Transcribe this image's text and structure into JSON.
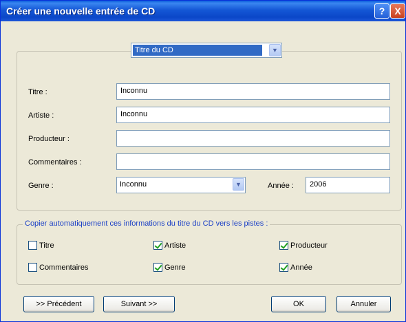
{
  "window": {
    "title": "Créer une nouvelle entrée de CD",
    "help_icon": "?",
    "close_icon": "X"
  },
  "field_selector": {
    "selected": "Titre du CD",
    "icon": "chevron-down-icon"
  },
  "fields": {
    "titre": {
      "label": "Titre :",
      "value": "Inconnu"
    },
    "artiste": {
      "label": "Artiste :",
      "value": "Inconnu"
    },
    "producteur": {
      "label": "Producteur :",
      "value": ""
    },
    "commentaires": {
      "label": "Commentaires :",
      "value": ""
    },
    "genre": {
      "label": "Genre :",
      "value": "Inconnu"
    },
    "annee": {
      "label": "Année :",
      "value": "2006"
    }
  },
  "copy_section": {
    "legend": "Copier automatiquement ces informations du titre du CD vers les pistes :",
    "options": [
      {
        "label": "Titre",
        "checked": false
      },
      {
        "label": "Artiste",
        "checked": true
      },
      {
        "label": "Producteur",
        "checked": true
      },
      {
        "label": "Commentaires",
        "checked": false
      },
      {
        "label": "Genre",
        "checked": true
      },
      {
        "label": "Année",
        "checked": true
      }
    ]
  },
  "buttons": {
    "previous": ">> Précédent",
    "next": "Suivant >>",
    "ok": "OK",
    "cancel": "Annuler"
  }
}
